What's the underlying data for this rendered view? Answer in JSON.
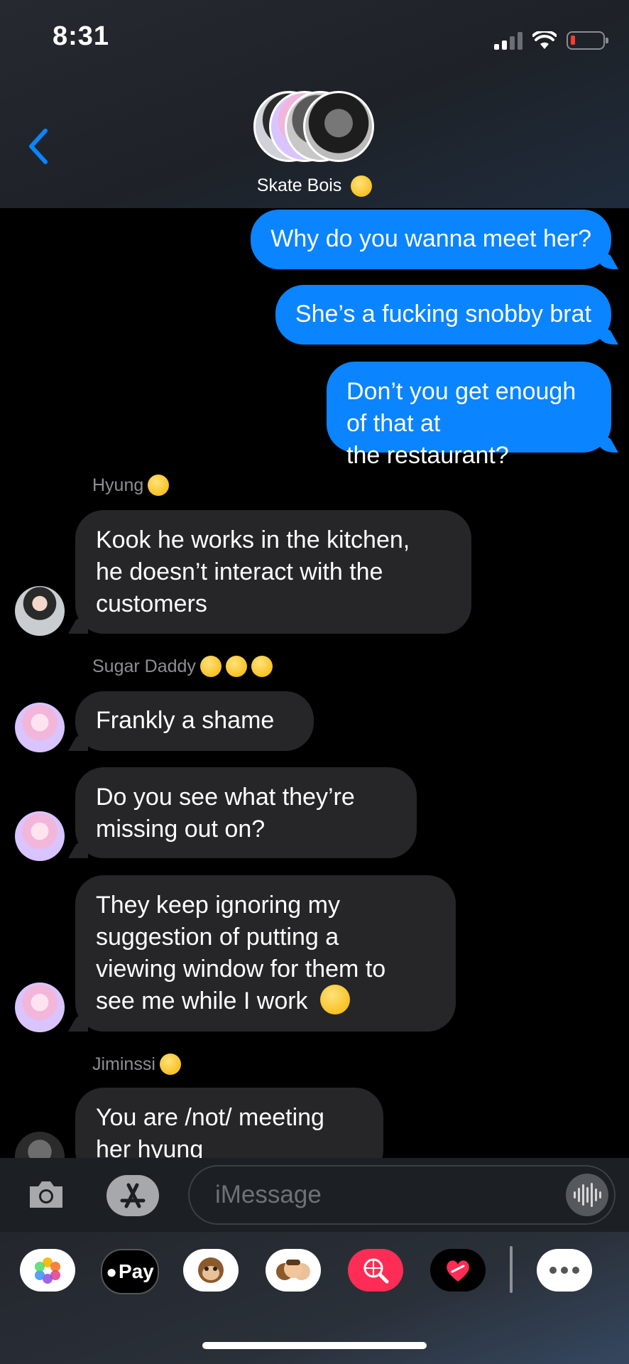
{
  "status_bar": {
    "time": "8:31",
    "icons": [
      "signal-icon",
      "wifi-icon",
      "battery-low-icon"
    ],
    "battery_color": "#ff3b30"
  },
  "header": {
    "group_name": "Skate Bois",
    "group_emoji": "star-struck-emoji"
  },
  "messages": [
    {
      "direction": "outgoing",
      "text_lines": [
        "Why do you wanna meet her?"
      ]
    },
    {
      "direction": "outgoing",
      "text_lines": [
        "She’s a fucking snobby brat"
      ]
    },
    {
      "direction": "outgoing",
      "text_lines": [
        "Don’t you get enough of that at",
        "the restaurant?"
      ]
    },
    {
      "direction": "incoming",
      "sender": "Hyung",
      "sender_emoji": "relieved-face-emoji",
      "text_lines": [
        "Kook he works in the kitchen,",
        "he doesn’t interact with the",
        "customers"
      ]
    },
    {
      "direction": "incoming",
      "sender": "Sugar Daddy",
      "sender_emoji": "star-struck-emoji x3",
      "text_lines": [
        "Frankly a shame"
      ]
    },
    {
      "direction": "incoming",
      "sender": "Sugar Daddy",
      "text_lines": [
        "Do you see what they’re",
        "missing out on?"
      ]
    },
    {
      "direction": "incoming",
      "sender": "Sugar Daddy",
      "text_lines": [
        "They keep ignoring my",
        "suggestion of putting a",
        "viewing window for them to",
        "see me while I work"
      ],
      "trailing_emoji": "pensive-face-emoji"
    },
    {
      "direction": "incoming",
      "sender": "Jiminssi",
      "sender_emoji": "zany-face-emoji",
      "text_lines": [
        "You are /not/ meeting",
        "her hyung"
      ]
    }
  ],
  "input_bar": {
    "placeholder": "iMessage"
  },
  "app_drawer": {
    "apps": [
      "photos-icon",
      "apple-pay-icon",
      "animoji-icon",
      "memoji-icon",
      "web-search-icon",
      "digital-touch-icon",
      "more-icon"
    ],
    "apple_pay_label": "Pay"
  },
  "colors": {
    "outgoing_bubble": "#0a84ff",
    "incoming_bubble": "#262628",
    "sender_label": "#8e8e93"
  }
}
